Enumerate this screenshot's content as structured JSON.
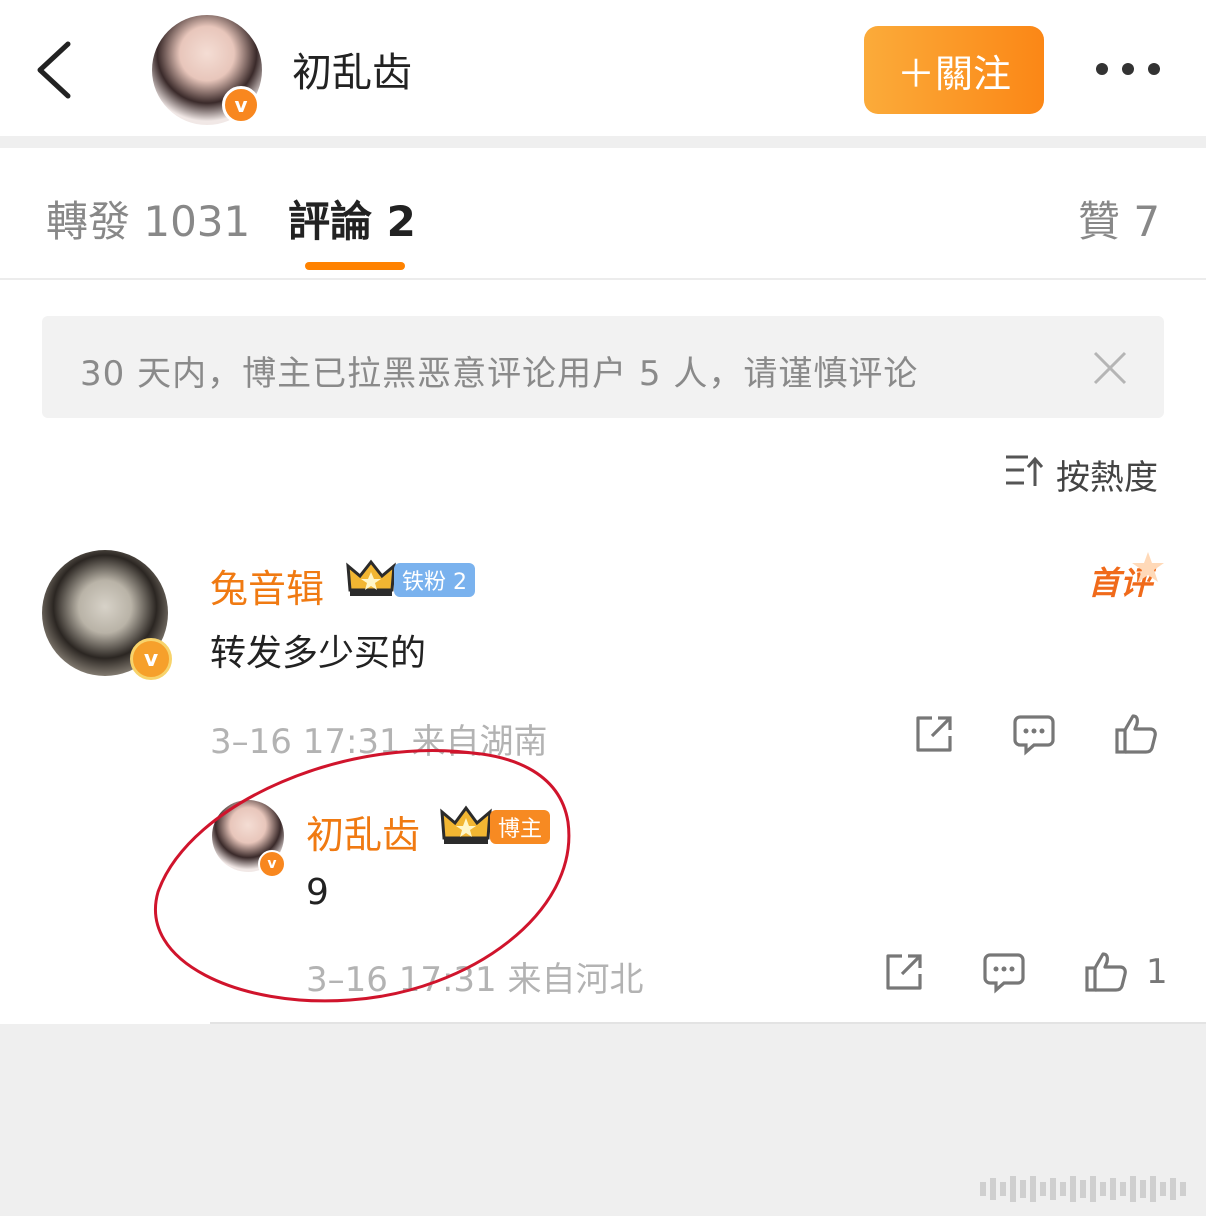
{
  "header": {
    "title": "初乱齿",
    "follow_label": "＋關注"
  },
  "tabs": [
    {
      "label": "轉發 1031"
    },
    {
      "label": "評論 2"
    },
    {
      "label": "贊 7"
    }
  ],
  "notice": {
    "text": "30 天内，博主已拉黑恶意评论用户 5 人，请谨慎评论"
  },
  "sort": {
    "label": "按熱度"
  },
  "comments": [
    {
      "author": "兔音辑",
      "fan_badge": "铁粉 2",
      "first_badge": "首评",
      "content": "转发多少买的",
      "meta": "3–16 17:31 来自湖南"
    },
    {
      "author": "初乱齿",
      "role_badge": "博主",
      "content": "9",
      "meta": "3–16 17:31 来自河北",
      "likes": "1"
    }
  ],
  "colors": {
    "accent": "#ff8200",
    "username": "#f07a12",
    "annotation_circle": "#d0142c"
  }
}
